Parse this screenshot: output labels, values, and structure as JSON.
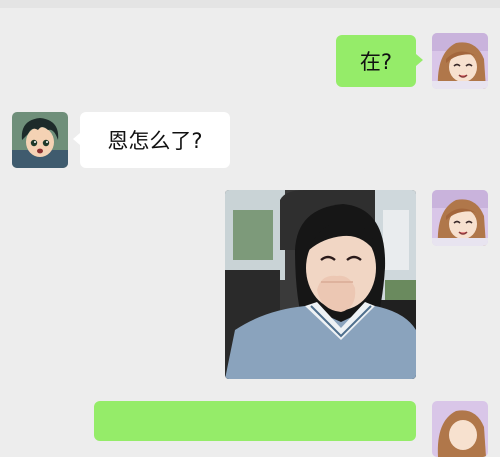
{
  "chat": {
    "messages": [
      {
        "direction": "sent",
        "type": "text",
        "text": "在?",
        "avatar_icon": "anime-girl-avatar-icon"
      },
      {
        "direction": "received",
        "type": "text",
        "text": "恩怎么了?",
        "avatar_icon": "anime-boy-avatar-icon"
      },
      {
        "direction": "sent",
        "type": "image",
        "image_icon": "selfie-photo-image",
        "avatar_icon": "anime-girl-avatar-icon"
      },
      {
        "direction": "sent",
        "type": "text",
        "text": "",
        "avatar_icon": "anime-girl-avatar-icon"
      }
    ]
  },
  "colors": {
    "background": "#ededed",
    "sent_bubble": "#95ec69",
    "received_bubble": "#ffffff"
  }
}
